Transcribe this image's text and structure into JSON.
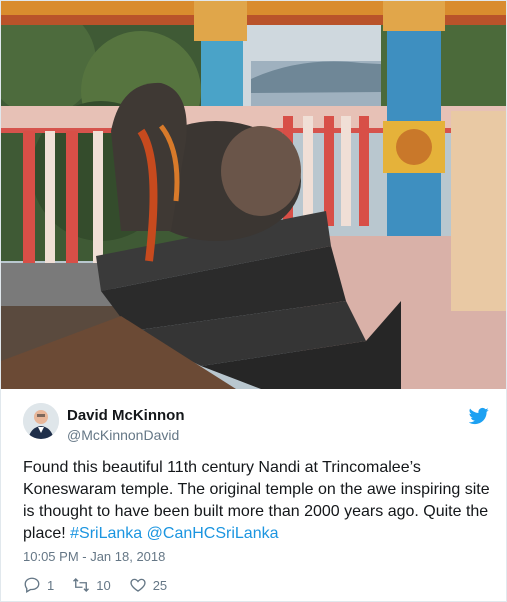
{
  "tweet": {
    "author_name": "David McKinnon",
    "author_handle": "@McKinnonDavid",
    "text_part1": "Found this beautiful 11th century Nandi at Trincomalee’s Koneswaram temple. The original temple on the awe inspiring site is thought to have been built more than 2000 years ago. Quite the place! ",
    "hashtag": "#SriLanka",
    "mention": "@CanHCSriLanka",
    "timestamp": "10:05 PM - Jan 18, 2018",
    "replies": "1",
    "retweets": "10",
    "likes": "25"
  },
  "icons": {
    "bird": "twitter-bird-icon",
    "reply": "reply-icon",
    "retweet": "retweet-icon",
    "like": "heart-icon"
  },
  "colors": {
    "link": "#1b95e0",
    "secondary_text": "#657786",
    "primary_text": "#14171a"
  }
}
